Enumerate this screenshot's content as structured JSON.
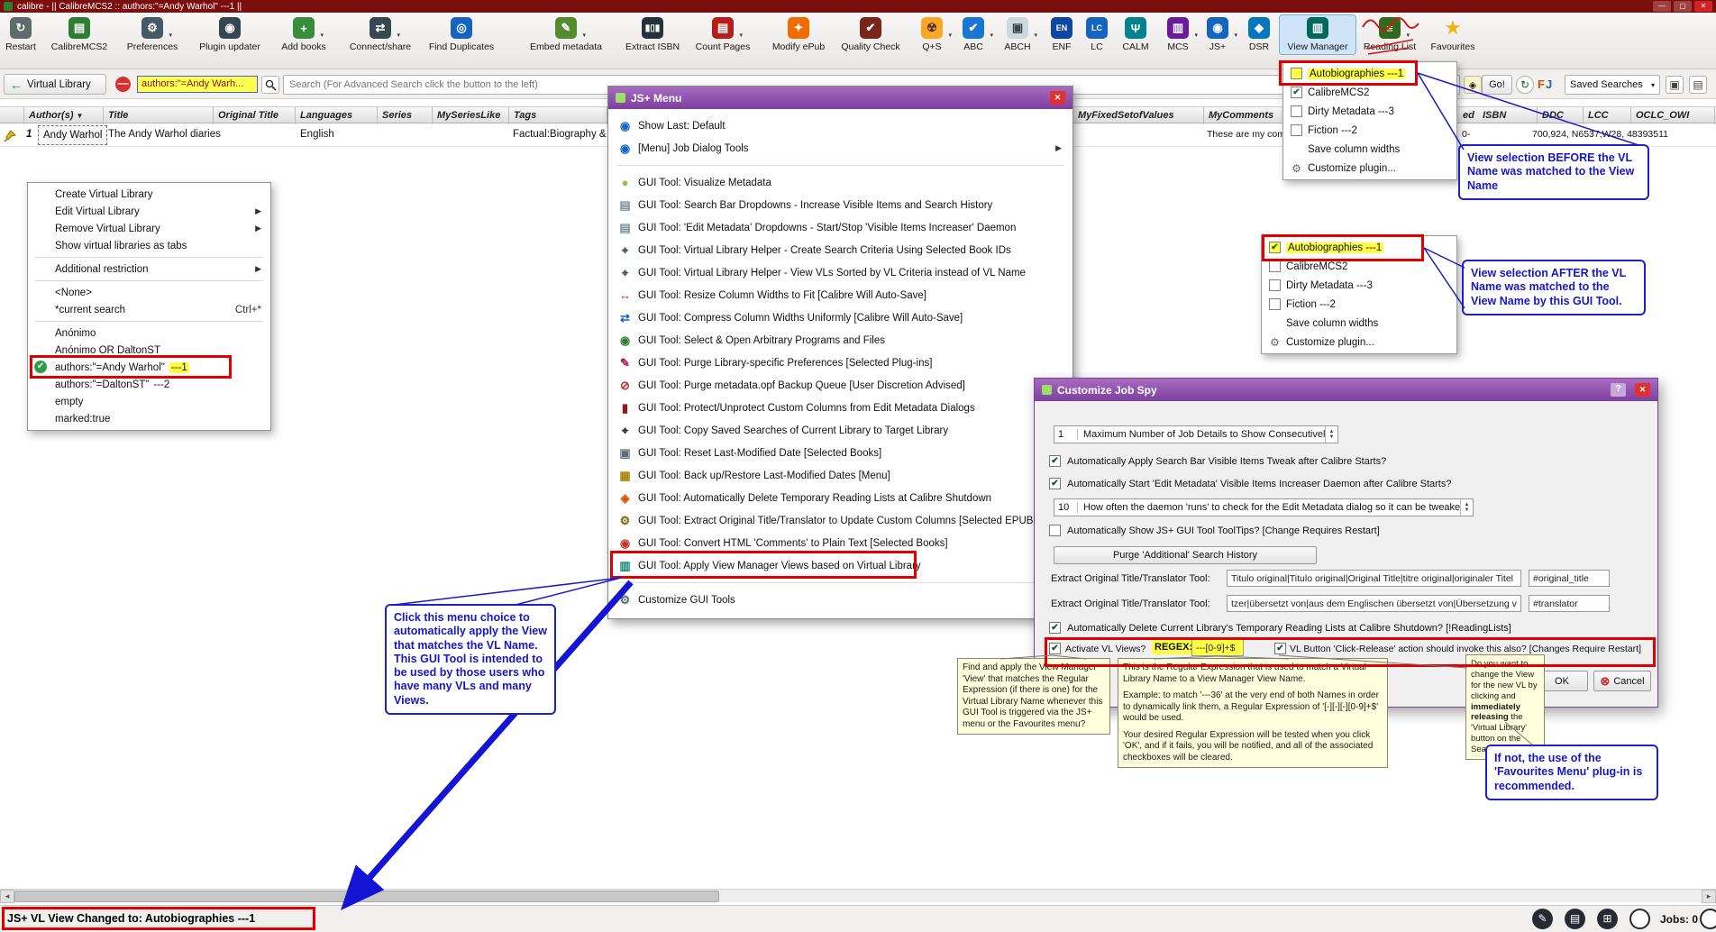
{
  "colors": {
    "accent_red": "#e00000",
    "annotation_blue": "#1a1acc",
    "highlight_yellow": "#ffff43",
    "arrow_blue": "#1414d4"
  },
  "window": {
    "title": "calibre - || CalibreMCS2 :: authors:\"=Andy Warhol\"  ---1 ||",
    "status_message": "JS+ VL View Changed to: Autobiographies ---1",
    "jobs_label": "Jobs: 0"
  },
  "toolbar": {
    "items": [
      {
        "label": "Restart"
      },
      {
        "label": "CalibreMCS2"
      },
      {
        "label": "Preferences"
      },
      {
        "label": "Plugin updater"
      },
      {
        "label": "Add books"
      },
      {
        "label": "Connect/share"
      },
      {
        "label": "Find Duplicates"
      },
      {
        "label": "Embed metadata"
      },
      {
        "label": "Extract ISBN"
      },
      {
        "label": "Count Pages"
      },
      {
        "label": "Modify ePub"
      },
      {
        "label": "Quality Check"
      },
      {
        "label": "Q+S"
      },
      {
        "label": "ABC"
      },
      {
        "label": "ABCH"
      },
      {
        "label": "ENF"
      },
      {
        "label": "LC"
      },
      {
        "label": "CALM"
      },
      {
        "label": "MCS"
      },
      {
        "label": "JS+"
      },
      {
        "label": "DSR"
      },
      {
        "label": "View Manager"
      },
      {
        "label": "Reading List"
      },
      {
        "label": "Favourites"
      }
    ]
  },
  "search_bar": {
    "virtual_library_label": "Virtual Library",
    "vl_indicator": "authors:\"=Andy Warh...",
    "placeholder": "Search (For Advanced Search click the button to the left)",
    "go_label": "Go!",
    "fj_f": "F",
    "fj_j": "J",
    "saved_searches_label": "Saved Searches"
  },
  "table": {
    "headers": {
      "author": "Author(s)",
      "title": "Title",
      "original_title": "Original Title",
      "languages": "Languages",
      "series": "Series",
      "myserieslike": "MySeriesLike",
      "tags": "Tags",
      "myfixedsetofvalues": "MyFixedSetofValues",
      "mycomments": "MyComments",
      "ed_partial": "ed",
      "isbn": "ISBN",
      "ddc": "DDC",
      "lcc": "LCC",
      "oclc_owi": "OCLC_OWI"
    },
    "row": {
      "num": "1",
      "author": "Andy Warhol",
      "title": "The Andy Warhol diaries",
      "language": "English",
      "tags": "Factual:Biography &",
      "mycomments": "These are my com",
      "misc_left": "0-",
      "codes": "700,924, N6537,W28, 48393511"
    }
  },
  "vl_menu": {
    "items": [
      {
        "label": "Create Virtual Library"
      },
      {
        "label": "Edit Virtual Library"
      },
      {
        "label": "Remove Virtual Library"
      },
      {
        "label": "Show virtual libraries as tabs"
      },
      {
        "label": "Additional restriction"
      },
      {
        "label": "<None>"
      },
      {
        "label": "*current search",
        "shortcut": "Ctrl+*"
      },
      {
        "label": "Anónimo"
      },
      {
        "label": "Anónimo OR DaltonST"
      },
      {
        "label": "authors:\"=Andy Warhol\"",
        "suffix": "---1"
      },
      {
        "label": "authors:\"=DaltonST\"",
        "suffix": "---2"
      },
      {
        "label": "empty"
      },
      {
        "label": "marked:true"
      }
    ]
  },
  "jsplus_menu": {
    "title": "JS+ Menu",
    "items": [
      {
        "label": "Show Last: Default"
      },
      {
        "label": "[Menu] Job Dialog Tools"
      },
      {
        "label": "GUI Tool:  Visualize Metadata"
      },
      {
        "label": "GUI Tool:  Search Bar Dropdowns - Increase Visible Items and Search History"
      },
      {
        "label": "GUI Tool:  'Edit Metadata' Dropdowns - Start/Stop 'Visible Items Increaser' Daemon"
      },
      {
        "label": "GUI Tool:  Virtual Library Helper - Create Search Criteria Using Selected Book IDs"
      },
      {
        "label": "GUI Tool:  Virtual Library Helper - View VLs Sorted by VL Criteria instead of VL Name"
      },
      {
        "label": "GUI Tool:  Resize Column Widths to Fit [Calibre Will Auto-Save]"
      },
      {
        "label": "GUI Tool:  Compress Column Widths Uniformly [Calibre Will Auto-Save]"
      },
      {
        "label": "GUI Tool:  Select & Open Arbitrary Programs and Files"
      },
      {
        "label": "GUI Tool:  Purge Library-specific Preferences [Selected Plug-ins]"
      },
      {
        "label": "GUI Tool:  Purge metadata.opf Backup Queue [User Discretion Advised]"
      },
      {
        "label": "GUI Tool:  Protect/Unprotect Custom Columns from Edit Metadata Dialogs"
      },
      {
        "label": "GUI Tool:  Copy Saved Searches of Current Library to Target Library"
      },
      {
        "label": "GUI Tool:  Reset Last-Modified Date [Selected Books]"
      },
      {
        "label": "GUI Tool:  Back up/Restore Last-Modified Dates [Menu]"
      },
      {
        "label": "GUI Tool:  Automatically Delete Temporary Reading Lists at Calibre Shutdown"
      },
      {
        "label": "GUI Tool:  Extract Original Title/Translator to Update Custom Columns [Selected EPUBs]"
      },
      {
        "label": "GUI Tool:  Convert HTML 'Comments' to Plain Text [Selected Books]"
      },
      {
        "label": "GUI Tool:  Apply View Manager Views based on Virtual Library"
      },
      {
        "label": "Customize GUI Tools"
      }
    ]
  },
  "view_menu_before": {
    "items": [
      {
        "label": "Autobiographies ---1"
      },
      {
        "label": "CalibreMCS2"
      },
      {
        "label": "Dirty Metadata ---3"
      },
      {
        "label": "Fiction ---2"
      },
      {
        "label": "Save column widths"
      },
      {
        "label": "Customize plugin..."
      }
    ]
  },
  "view_menu_after": {
    "items": [
      {
        "label": "Autobiographies ---1"
      },
      {
        "label": "CalibreMCS2"
      },
      {
        "label": "Dirty Metadata ---3"
      },
      {
        "label": "Fiction ---2"
      },
      {
        "label": "Save column widths"
      },
      {
        "label": "Customize plugin..."
      }
    ]
  },
  "job_spy": {
    "title": "Customize Job Spy",
    "help": "?",
    "max_jobs_value": "1",
    "max_jobs_label": "Maximum Number of Job Details to Show Consecutively",
    "auto_tweak": "Automatically Apply Search Bar Visible Items Tweak after Calibre Starts?",
    "auto_daemon": "Automatically Start 'Edit Metadata' Visible Items Increaser Daemon after Calibre Starts?",
    "daemon_freq_value": "10",
    "daemon_freq_label": "How often the daemon 'runs' to check for the Edit Metadata dialog so it can be tweaked",
    "show_tooltips": "Automatically Show JS+ GUI Tool ToolTips? [Change Requires Restart]",
    "purge_button": "Purge 'Additional' Search History",
    "extract_label": "Extract Original Title/Translator Tool:",
    "extract_value_1": "Titulo original|Titulo original|Original Title|titre original|originaler Titel",
    "extract_col_1": "#original_title",
    "extract_value_2": "tzer|übersetzt von|aus dem Englischen übersetzt von|Übersetzung von",
    "extract_col_2": "#translator",
    "auto_delete": "Automatically Delete Current Library's Temporary Reading Lists at Calibre Shutdown? [!ReadingLists]",
    "activate_label": "Activate VL Views?",
    "regex_label": "REGEX:",
    "regex_value": "---[0-9]+$",
    "vl_button_label": "VL Button 'Click-Release' action should invoke this also? [Changes Require Restart]",
    "ok": "OK",
    "cancel": "Cancel"
  },
  "annotations": {
    "before": "View selection BEFORE the VL Name was matched to the View Name",
    "after": "View selection AFTER the VL Name was matched to the View Name by this GUI Tool.",
    "click_menu": "Click this menu choice to automatically apply the View that matches the VL Name.  This GUI Tool is intended to be used by those users who have many VLs and many Views.",
    "if_not": "If not, the use of the 'Favourites Menu' plug-in is recommended."
  },
  "tooltips": {
    "find_apply": "Find and apply the View Manager 'View' that matches the Regular Expression (if there is one) for the Virtual Library Name whenever this GUI Tool is triggered via the JS+ menu or the Favourites menu?",
    "regex_p1": "This is the Regular Expression that is used to match a Virtual Library Name to a View Manager View Name.",
    "regex_p2": "Example: to match '---36' at the very end of both Names in order to dynamically link them, a Regular Expression of '[-][-][-][0-9]+$' would be used.",
    "regex_p3": "Your desired Regular Expression will be tested when you click 'OK', and if it fails, you will be notified, and all of the associated checkboxes will be cleared.",
    "change_p1": "Do you want to change the View for the new VL by clicking and ",
    "change_bold": "immediately releasing",
    "change_p2": " the 'Virtual Library' button on the Search Bar?"
  }
}
